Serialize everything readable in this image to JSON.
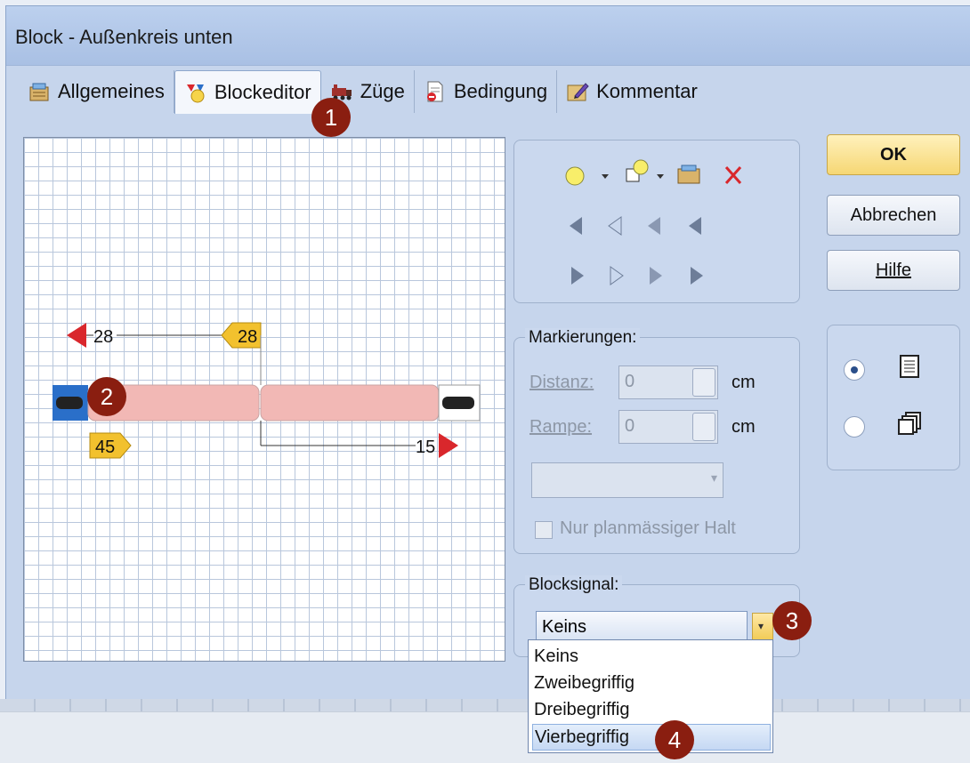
{
  "window": {
    "title": "Block - Außenkreis unten"
  },
  "tabs": [
    {
      "label": "Allgemeines",
      "icon": "properties-icon"
    },
    {
      "label": "Blockeditor",
      "icon": "block-editor-icon"
    },
    {
      "label": "Züge",
      "icon": "train-icon"
    },
    {
      "label": "Bedingung",
      "icon": "condition-icon"
    },
    {
      "label": "Kommentar",
      "icon": "comment-icon"
    }
  ],
  "editor": {
    "markers": {
      "left_top_value": "28",
      "left_top_tag": "28",
      "bottom_left_tag": "45",
      "right_bottom_value": "15"
    }
  },
  "buttons": {
    "ok": "OK",
    "cancel": "Abbrechen",
    "help": "Hilfe"
  },
  "markierungen": {
    "label": "Markierungen:",
    "distanz_label": "Distanz:",
    "distanz_value": "0",
    "rampe_label": "Rampe:",
    "rampe_value": "0",
    "unit": "cm",
    "checkbox_label": "Nur planmässiger Halt"
  },
  "blocksignal": {
    "label": "Blocksignal:",
    "selected": "Keins",
    "options": [
      "Keins",
      "Zweibegriffig",
      "Dreibegriffig",
      "Vierbegriffig"
    ]
  },
  "badges": [
    "1",
    "2",
    "3",
    "4"
  ],
  "colors": {
    "accent_yellow": "#f2c12e",
    "marker_red": "#d9272c",
    "block_fill": "#f2b8b5",
    "badge": "#8a1e10"
  }
}
